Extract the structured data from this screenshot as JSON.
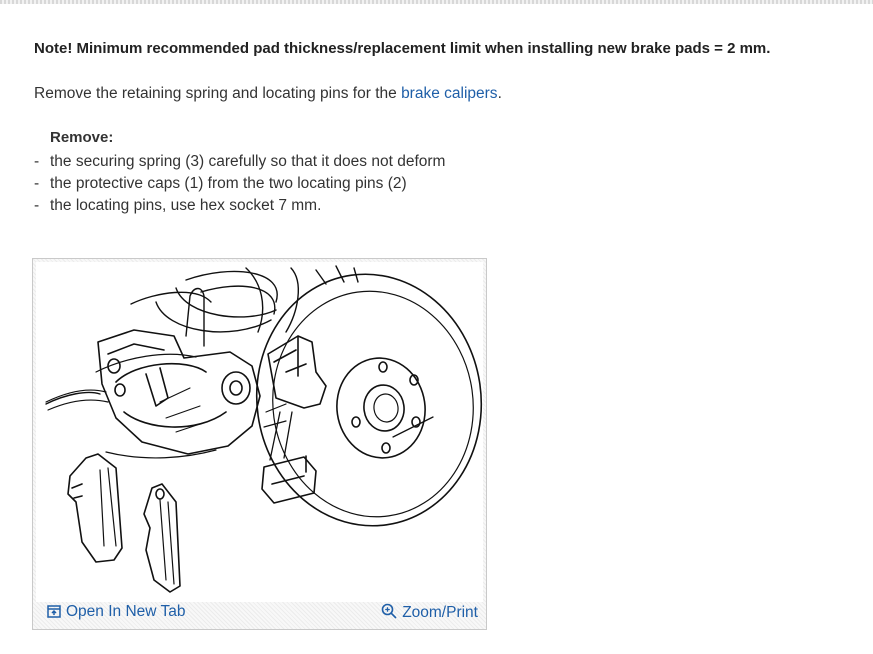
{
  "note": "Note! Minimum recommended pad thickness/replacement limit when installing new brake pads = 2 mm.",
  "intro": {
    "before": "Remove the retaining spring and locating pins for the ",
    "link": "brake calipers",
    "after": "."
  },
  "remove_heading": "Remove:",
  "steps": [
    "the securing spring (3) carefully so that it does not deform",
    "the protective caps (1) from the two locating pins (2)",
    "the locating pins, use hex socket 7 mm."
  ],
  "figure": {
    "open_tab_label": "Open In New Tab",
    "zoom_label": "Zoom/Print"
  },
  "colors": {
    "link": "#1f5fa8",
    "text": "#333333"
  },
  "icons": {
    "open_tab": "open-in-new-tab-icon",
    "zoom": "zoom-magnifier-icon"
  }
}
